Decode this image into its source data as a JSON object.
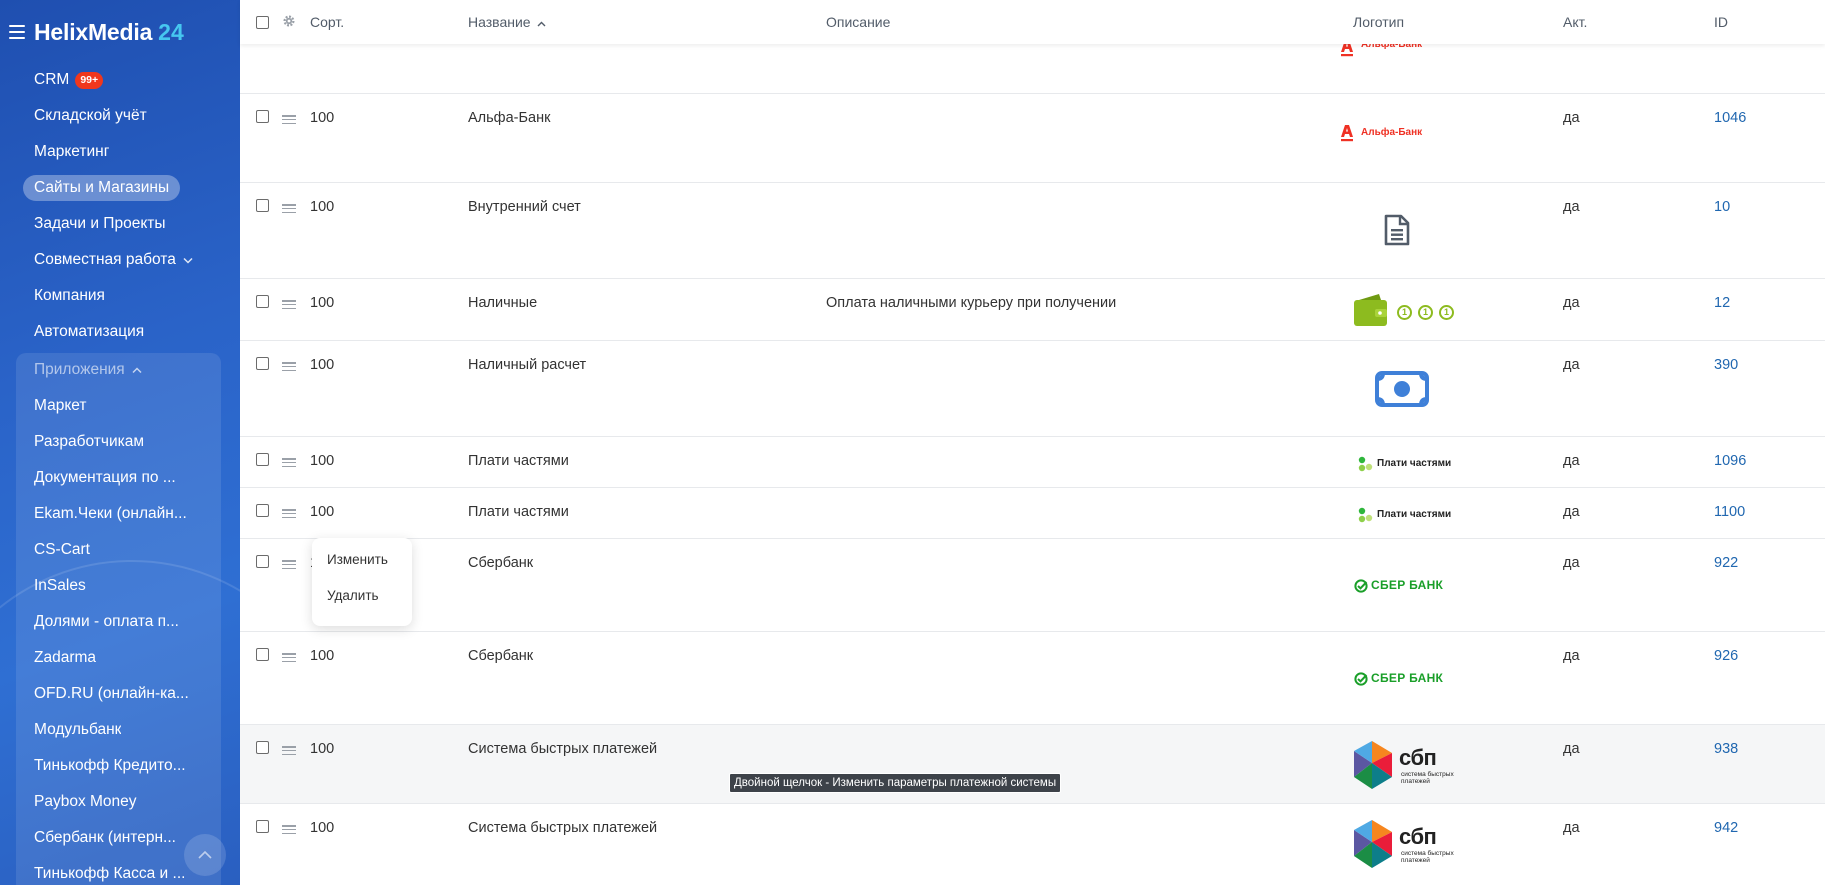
{
  "sidebar": {
    "brand": "HelixMedia",
    "brand_num": "24",
    "items": [
      {
        "label": "CRM",
        "badge": "99+"
      },
      {
        "label": "Складской учёт"
      },
      {
        "label": "Маркетинг"
      },
      {
        "label": "Сайты и Магазины",
        "active": true
      },
      {
        "label": "Задачи и Проекты"
      },
      {
        "label": "Совместная работа"
      },
      {
        "label": "Компания"
      },
      {
        "label": "Автоматизация"
      }
    ],
    "apps_label": "Приложения",
    "apps": [
      "Маркет",
      "Разработчикам",
      "Документация по ...",
      "Ekam.Чеки (онлайн...",
      "CS-Cart",
      "InSales",
      "Долями - оплата п...",
      "Zadarma",
      "OFD.RU (онлайн-ка...",
      "Модульбанк",
      "Тинькофф Кредито...",
      "Paybox Money",
      "Сбербанк (интерн...",
      "Тинькофф Касса и ..."
    ]
  },
  "table": {
    "headers": {
      "sort": "Сорт.",
      "name": "Название",
      "name_sort_arrow": "^",
      "description": "Описание",
      "logo": "Логотип",
      "active": "Акт.",
      "id": "ID"
    },
    "rows": [
      {
        "sort": "100",
        "name": "Альфа-Банк",
        "description": "",
        "logo": "alfa-bank-logo",
        "active": "да",
        "id": "1046"
      },
      {
        "sort": "100",
        "name": "Внутренний счет",
        "description": "",
        "logo": "document-icon",
        "active": "да",
        "id": "10"
      },
      {
        "sort": "100",
        "name": "Наличные",
        "description": "Оплата наличными курьеру при получении",
        "logo": "wallet-coins-logo",
        "active": "да",
        "id": "12"
      },
      {
        "sort": "100",
        "name": "Наличный расчет",
        "description": "",
        "logo": "banknote-icon",
        "active": "да",
        "id": "390"
      },
      {
        "sort": "100",
        "name": "Плати частями",
        "description": "",
        "logo": "plati-chastyami-logo",
        "active": "да",
        "id": "1096"
      },
      {
        "sort": "100",
        "name": "Плати частями",
        "description": "",
        "logo": "plati-chastyami-logo",
        "active": "да",
        "id": "1100"
      },
      {
        "sort": "100",
        "name": "Сбербанк",
        "description": "",
        "logo": "sberbank-logo",
        "active": "да",
        "id": "922"
      },
      {
        "sort": "100",
        "name": "Сбербанк",
        "description": "",
        "logo": "sberbank-logo",
        "active": "да",
        "id": "926"
      },
      {
        "sort": "100",
        "name": "Система быстрых платежей",
        "description": "",
        "logo": "sbp-logo",
        "active": "да",
        "id": "938"
      },
      {
        "sort": "100",
        "name": "Система быстрых платежей",
        "description": "",
        "logo": "sbp-logo",
        "active": "да",
        "id": "942"
      }
    ]
  },
  "logos": {
    "alfa": "Альфа-Банк",
    "plati": "Плати частями",
    "sber": "СБЕР БАНК",
    "sbp": "сбп",
    "sbp_sub1": "система быстрых",
    "sbp_sub2": "платежей",
    "coin": "1"
  },
  "context_menu": {
    "edit": "Изменить",
    "delete": "Удалить"
  },
  "tooltip": "Двойной щелчок - Изменить параметры платежной системы",
  "colors": {
    "sidebar": "#2a63c8",
    "brand_num": "#46c7f0",
    "badge": "#f0371c",
    "link": "#2067b0",
    "alfa": "#ef3124",
    "sber": "#1a9f29",
    "cash_green": "#8dbb1f",
    "banknote": "#3f80d8"
  }
}
